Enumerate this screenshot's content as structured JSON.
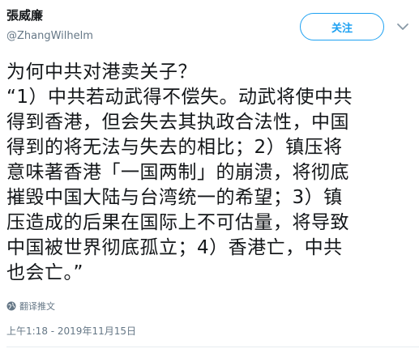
{
  "author": {
    "display_name": "張威廉",
    "handle": "@ZhangWilhelm"
  },
  "follow_button": {
    "label": "关注"
  },
  "tweet": {
    "lines": [
      "为何中共对港卖关子？",
      "“1）中共若动武得不偿失。动武将使中共",
      "得到香港，但会失去其执政合法性，中国",
      "得到的将无法与失去的相比；2）镇压将",
      "意味著香港「一国两制」的崩溃，将彻底",
      "摧毁中国大陆与台湾统一的希望；3）镇",
      "压造成的后果在国际上不可估量，将导致",
      "中国被世界彻底孤立；4）香港亡，中共",
      "也会亡。”"
    ]
  },
  "translate": {
    "label": "翻译推文",
    "icon": "globe-icon"
  },
  "timestamp": "上午1:18 - 2019年11月15日",
  "colors": {
    "accent": "#1da1f2",
    "text": "#14171a",
    "secondary": "#657786"
  }
}
